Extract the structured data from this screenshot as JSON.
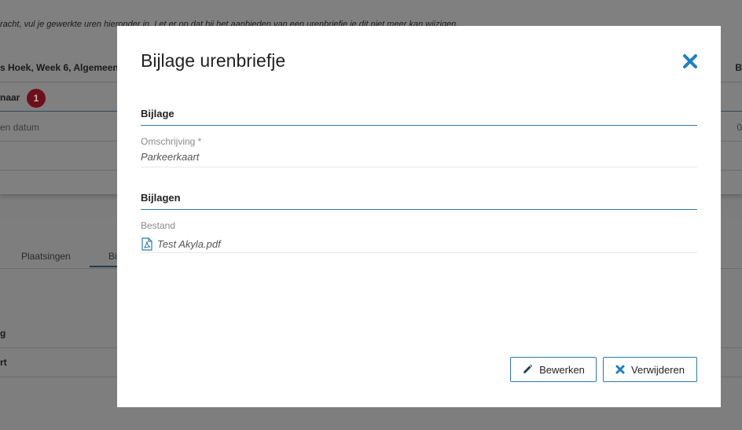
{
  "background": {
    "notice": "racht, vul je gewerkte uren hieronder in. Let er op dat bij het aanbieden van een urenbriefje je dit niet meer kan wijzigen.",
    "header": "s Hoek, Week 6, Algemeen",
    "header_right": "B",
    "row_label": "naar",
    "badge_count": "1",
    "date_text": "en datum",
    "date_right": "0",
    "tabs": [
      "Plaatsingen",
      "Bi"
    ],
    "list_items": [
      "g",
      "rt"
    ]
  },
  "modal": {
    "title": "Bijlage urenbriefje",
    "sections": {
      "bijlage": {
        "title": "Bijlage",
        "field_label": "Omschrijving *",
        "field_value": "Parkeerkaart"
      },
      "bijlagen": {
        "title": "Bijlagen",
        "field_label": "Bestand",
        "file_name": "Test Akyla.pdf"
      }
    },
    "buttons": {
      "edit": "Bewerken",
      "delete": "Verwijderen"
    },
    "icons": {
      "close": "close-icon",
      "file": "pdf-file-icon",
      "edit": "pencil-icon",
      "delete": "x-icon"
    },
    "colors": {
      "accent": "#2a7ab0",
      "close": "#1f7fc2"
    }
  }
}
